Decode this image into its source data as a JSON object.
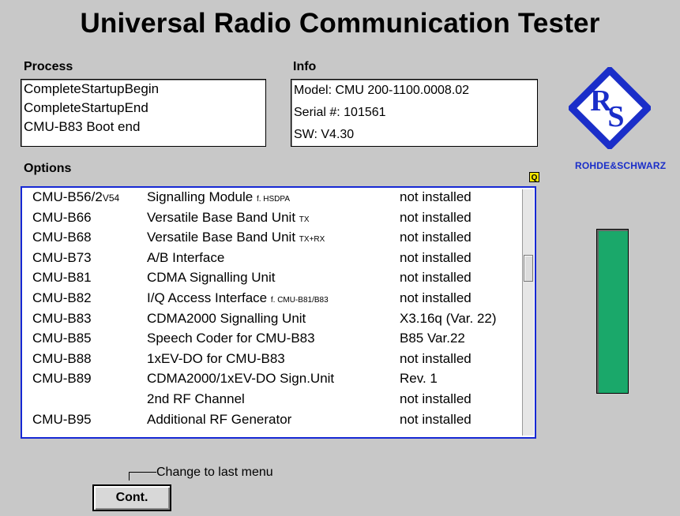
{
  "title": "Universal Radio Communication Tester",
  "process": {
    "label": "Process",
    "lines": [
      "CompleteStartupBegin",
      "CompleteStartupEnd",
      "CMU-B83 Boot end"
    ]
  },
  "info": {
    "label": "Info",
    "lines": [
      "Model: CMU 200-1100.0008.02",
      "Serial #: 101561",
      "SW: V4.30"
    ]
  },
  "brand": {
    "logo_letters": "RS",
    "name": "ROHDE&SCHWARZ"
  },
  "options": {
    "label": "Options",
    "badge": "Q",
    "rows": [
      {
        "code": "CMU-B56/2",
        "code_suffix": "V54",
        "desc": "Signalling Module",
        "desc_note": "f. HSDPA",
        "status": "not installed"
      },
      {
        "code": "CMU-B66",
        "code_suffix": "",
        "desc": "Versatile Base Band Unit",
        "desc_note": "TX",
        "status": "not installed"
      },
      {
        "code": "CMU-B68",
        "code_suffix": "",
        "desc": "Versatile Base Band Unit",
        "desc_note": "TX+RX",
        "status": "not installed"
      },
      {
        "code": "CMU-B73",
        "code_suffix": "",
        "desc": "A/B Interface",
        "desc_note": "",
        "status": "not installed"
      },
      {
        "code": "CMU-B81",
        "code_suffix": "",
        "desc": "CDMA Signalling Unit",
        "desc_note": "",
        "status": "not installed"
      },
      {
        "code": "CMU-B82",
        "code_suffix": "",
        "desc": "I/Q Access Interface",
        "desc_note": "f. CMU-B81/B83",
        "status": "not installed"
      },
      {
        "code": "CMU-B83",
        "code_suffix": "",
        "desc": "CDMA2000 Signalling Unit",
        "desc_note": "",
        "status": "X3.16q (Var. 22)"
      },
      {
        "code": "CMU-B85",
        "code_suffix": "",
        "desc": "Speech Coder for CMU-B83",
        "desc_note": "",
        "status": "B85 Var.22"
      },
      {
        "code": "CMU-B88",
        "code_suffix": "",
        "desc": "1xEV-DO for CMU-B83",
        "desc_note": "",
        "status": "not installed"
      },
      {
        "code": "CMU-B89",
        "code_suffix": "",
        "desc": "CDMA2000/1xEV-DO Sign.Unit",
        "desc_note": "",
        "status": "Rev. 1"
      },
      {
        "code": "",
        "code_suffix": "",
        "desc": "2nd RF Channel",
        "desc_note": "",
        "status": "not installed"
      },
      {
        "code": "CMU-B95",
        "code_suffix": "",
        "desc": "Additional RF Generator",
        "desc_note": "",
        "status": "not installed"
      }
    ]
  },
  "scroll": {
    "position": 0.3
  },
  "meter_color": "#1aa86a",
  "footer": {
    "hint": "Change to last menu",
    "cont_label": "Cont."
  }
}
